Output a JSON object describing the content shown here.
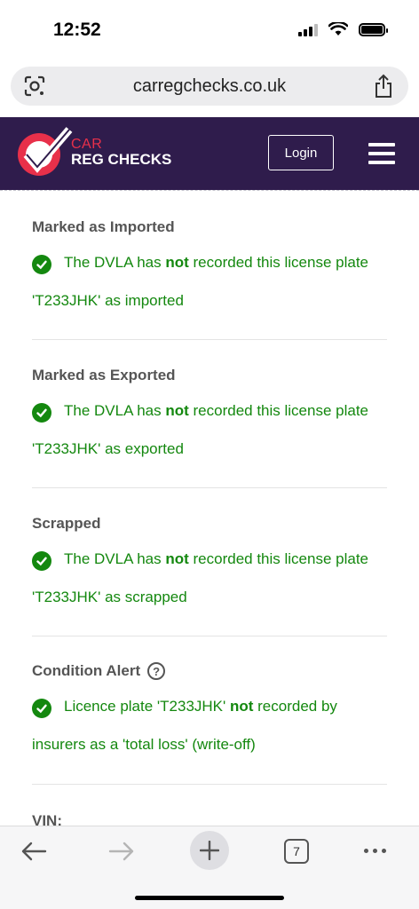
{
  "status_bar": {
    "time": "12:52"
  },
  "browser": {
    "url": "carregchecks.co.uk",
    "tab_count": "7"
  },
  "site": {
    "brand_line1": "CAR",
    "brand_line2": "REG CHECKS",
    "login_label": "Login",
    "colors": {
      "header_bg": "#2f1c4c",
      "brand_red": "#e8304a",
      "status_green": "#14880f"
    }
  },
  "sections": [
    {
      "title": "Marked as Imported",
      "line1_pre": "The DVLA has ",
      "line1_bold": "not",
      "line1_post": " recorded this license plate",
      "line2": "'T233JHK' as imported"
    },
    {
      "title": "Marked as Exported",
      "line1_pre": "The DVLA has ",
      "line1_bold": "not",
      "line1_post": " recorded this license plate",
      "line2": "'T233JHK' as exported"
    },
    {
      "title": "Scrapped",
      "line1_pre": "The DVLA has ",
      "line1_bold": "not",
      "line1_post": " recorded this license plate",
      "line2": "'T233JHK' as scrapped"
    },
    {
      "title": "Condition Alert",
      "help_icon_label": "?",
      "line1_pre": "Licence plate 'T233JHK' ",
      "line1_bold": "not",
      "line1_post": " recorded by",
      "line2": "insurers as a 'total loss' (write-off)"
    },
    {
      "title": "VIN:"
    }
  ]
}
